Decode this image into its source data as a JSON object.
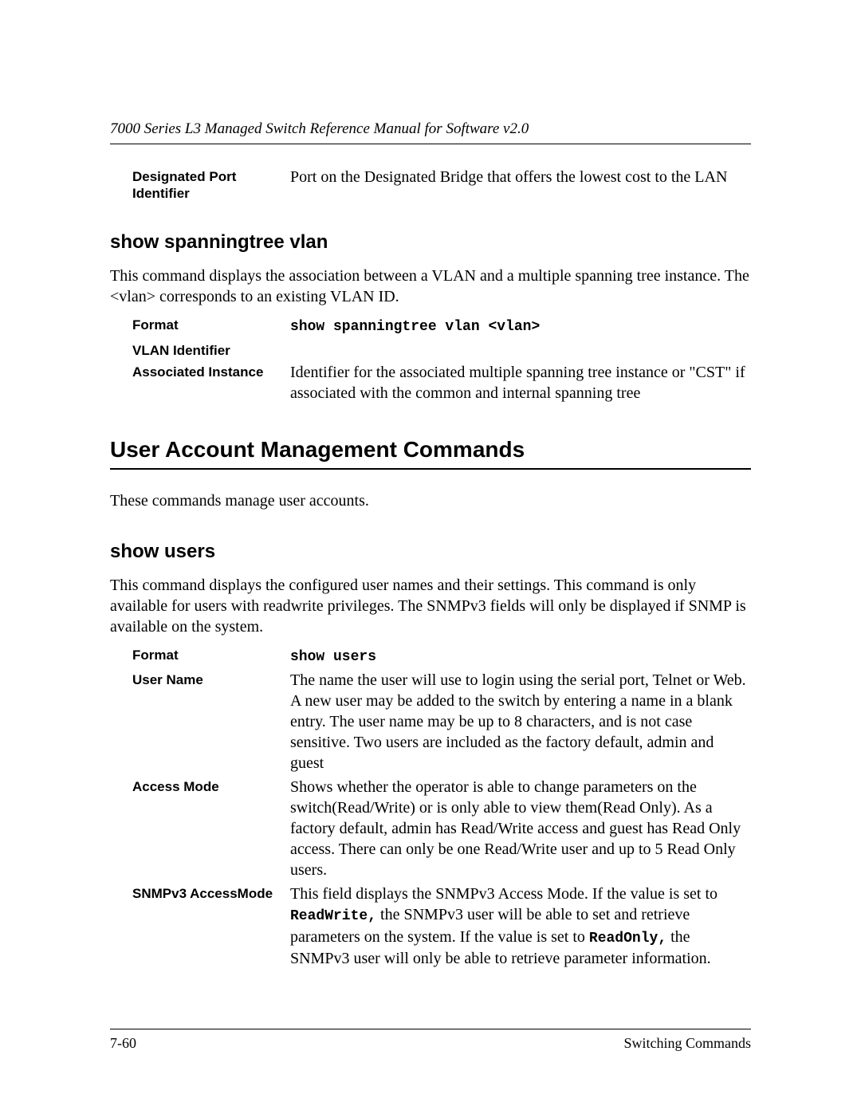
{
  "header": {
    "title": "7000 Series L3 Managed Switch Reference Manual for Software v2.0"
  },
  "top_def": {
    "term": "Designated Port Identifier",
    "desc": "Port on the Designated Bridge that offers the lowest cost to the LAN"
  },
  "sec_vlan": {
    "heading": "show spanningtree vlan",
    "intro": "This command displays the association between a VLAN and a multiple spanning tree instance. The <vlan> corresponds to an existing VLAN ID.",
    "rows": {
      "format_term": "Format",
      "format_cmd": "show spanningtree vlan <vlan>",
      "vlan_id_term": "VLAN Identifier",
      "assoc_term": "Associated Instance",
      "assoc_desc": "Identifier for the associated multiple spanning tree instance or \"CST\" if associated with the common and internal spanning tree"
    }
  },
  "sec_uam": {
    "heading": "User Account Management Commands",
    "intro": "These commands manage user accounts."
  },
  "sec_users": {
    "heading": "show users",
    "intro": "This command displays the configured user names and their settings. This command is only available for users with readwrite privileges. The SNMPv3 fields will only be displayed if SNMP is available on the system.",
    "rows": {
      "format_term": "Format",
      "format_cmd": "show users",
      "uname_term": "User Name",
      "uname_desc": "The name the user will use to login using the serial port, Telnet or Web. A new user may be added to the switch by entering a name in a blank entry. The user name may be up to 8 characters, and is not case sensitive. Two users are included as the factory default, admin and guest",
      "amode_term": "Access Mode",
      "amode_desc": "Shows whether the operator is able to change parameters on the switch(Read/Write) or is only able to view them(Read Only). As a factory default, admin has Read/Write access and guest has Read Only access. There can only be one Read/Write user and up to 5 Read Only users.",
      "snmp_term": "SNMPv3 AccessMode",
      "snmp_pre": "This field displays the SNMPv3 Access Mode. If the value is set to ",
      "snmp_rw": "ReadWrite,",
      "snmp_mid": "  the SNMPv3 user will be able to set and retrieve parameters on the system. If the value is set to ",
      "snmp_ro": "ReadOnly,",
      "snmp_post": "  the SNMPv3 user will only be able to retrieve parameter information."
    }
  },
  "footer": {
    "page_num": "7-60",
    "section": "Switching Commands"
  }
}
